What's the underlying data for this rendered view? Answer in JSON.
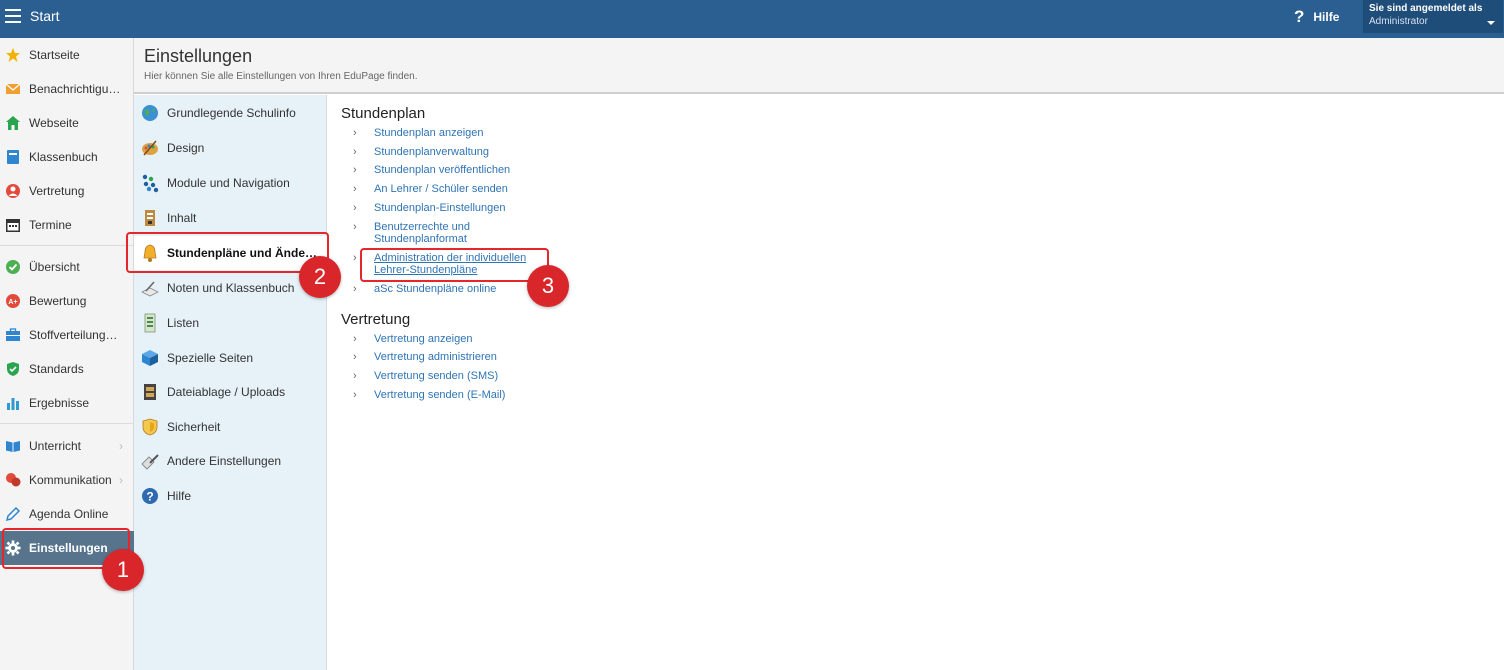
{
  "topbar": {
    "title": "Start",
    "help_label": "Hilfe",
    "help_icon": "?",
    "user_line1": "Sie sind angemeldet als",
    "user_line2": "Administrator"
  },
  "leftnav": {
    "items": [
      {
        "label": "Startseite",
        "icon": "star-icon",
        "color": "#f0b400"
      },
      {
        "label": "Benachrichtigungen",
        "icon": "envelope-icon",
        "color": "#f0a030"
      },
      {
        "label": "Webseite",
        "icon": "home-icon",
        "color": "#2aa44f"
      },
      {
        "label": "Klassenbuch",
        "icon": "book-icon",
        "color": "#2f86d0"
      },
      {
        "label": "Vertretung",
        "icon": "user-icon",
        "color": "#e24a3b"
      },
      {
        "label": "Termine",
        "icon": "calendar-icon",
        "color": "#333333"
      },
      {
        "label": "Übersicht",
        "icon": "check-icon",
        "color": "#4caf50"
      },
      {
        "label": "Bewertung",
        "icon": "grade-icon",
        "color": "#e24a3b"
      },
      {
        "label": "Stoffverteilungsplan",
        "icon": "briefcase-icon",
        "color": "#2f86d0"
      },
      {
        "label": "Standards",
        "icon": "shield-icon",
        "color": "#2aa44f"
      },
      {
        "label": "Ergebnisse",
        "icon": "bar-chart-icon",
        "color": "#2f9bd0"
      },
      {
        "label": "Unterricht",
        "icon": "open-book-icon",
        "color": "#2f86d0"
      },
      {
        "label": "Kommunikation",
        "icon": "chat-icon",
        "color": "#e24a3b"
      },
      {
        "label": "Agenda Online",
        "icon": "pen-icon",
        "color": "#2f86d0"
      },
      {
        "label": "Einstellungen",
        "icon": "gear-icon",
        "color": "#ffffff"
      }
    ]
  },
  "header": {
    "title": "Einstellungen",
    "subtitle": "Hier können Sie alle Einstellungen von Ihren EduPage finden."
  },
  "categories": [
    {
      "label": "Grundlegende Schulinfo",
      "icon": "globe-icon"
    },
    {
      "label": "Design",
      "icon": "palette-icon"
    },
    {
      "label": "Module und Navigation",
      "icon": "modules-icon"
    },
    {
      "label": "Inhalt",
      "icon": "content-icon"
    },
    {
      "label": "Stundenpläne und Änderungen",
      "icon": "bell-icon"
    },
    {
      "label": "Noten und Klassenbuch",
      "icon": "notebook-icon"
    },
    {
      "label": "Listen",
      "icon": "list-icon"
    },
    {
      "label": "Spezielle Seiten",
      "icon": "cube-icon"
    },
    {
      "label": "Dateiablage / Uploads",
      "icon": "file-cabinet-icon"
    },
    {
      "label": "Sicherheit",
      "icon": "shield-badge-icon"
    },
    {
      "label": "Andere Einstellungen",
      "icon": "tools-icon"
    },
    {
      "label": "Hilfe",
      "icon": "help-icon"
    }
  ],
  "content": {
    "stundenplan": {
      "title": "Stundenplan",
      "links": [
        "Stundenplan anzeigen",
        "Stundenplanverwaltung",
        "Stundenplan veröffentlichen",
        "An Lehrer / Schüler senden",
        "Stundenplan-Einstellungen",
        "Benutzerrechte und Stundenplanformat",
        "Administration der individuellen Lehrer-Stundenpläne",
        "aSc Stundenpläne online"
      ]
    },
    "vertretung": {
      "title": "Vertretung",
      "links": [
        "Vertretung anzeigen",
        "Vertretung administrieren",
        "Vertretung senden (SMS)",
        "Vertretung senden (E-Mail)"
      ]
    },
    "arrow": "›"
  },
  "callouts": [
    "1",
    "2",
    "3"
  ],
  "colors": {
    "topbar": "#2b5f91",
    "link": "#2f74b5",
    "highlight": "#e5262b",
    "active_nav": "#57748c"
  }
}
